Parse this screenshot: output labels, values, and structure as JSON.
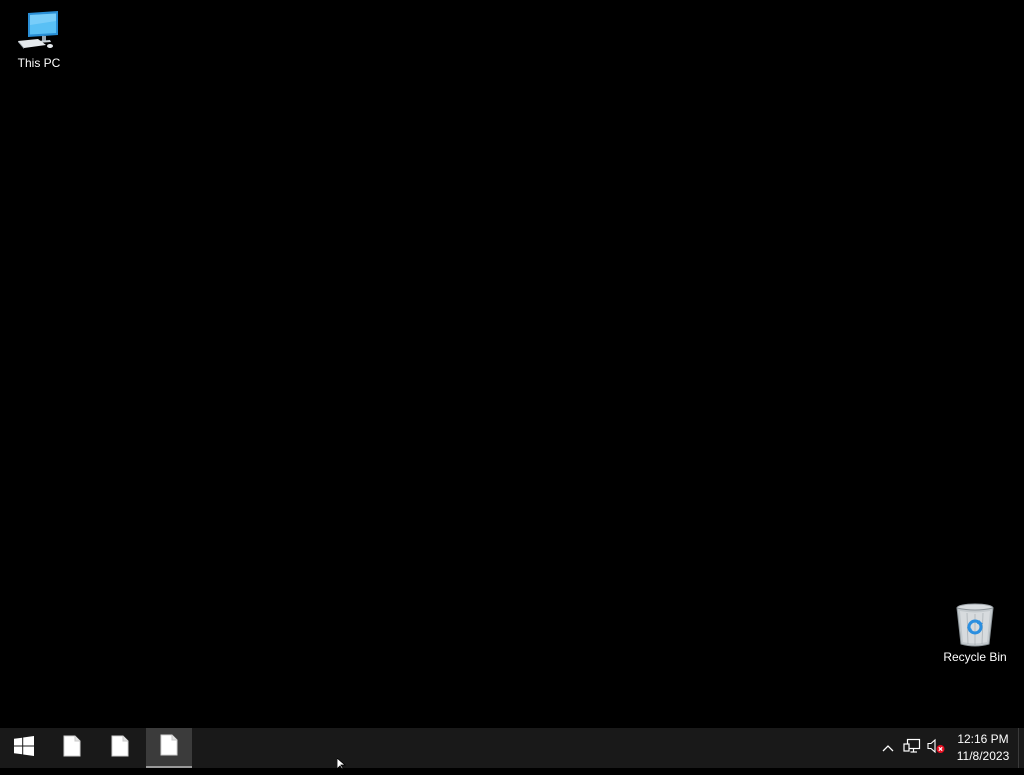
{
  "desktop": {
    "background_color": "#000000",
    "icons": [
      {
        "label": "This PC",
        "icon": "computer-icon"
      },
      {
        "label": "Recycle Bin",
        "icon": "recycle-bin-icon"
      }
    ]
  },
  "taskbar": {
    "background_color": "#191919",
    "start_icon": "windows-logo-icon",
    "apps": [
      {
        "icon": "document-icon",
        "active": false
      },
      {
        "icon": "document-icon",
        "active": false
      },
      {
        "icon": "document-icon",
        "active": true
      }
    ],
    "tray": {
      "icons": [
        "chevron-up-icon",
        "network-icon",
        "speaker-muted-icon"
      ],
      "time": "12:16 PM",
      "date": "11/8/2023"
    }
  }
}
